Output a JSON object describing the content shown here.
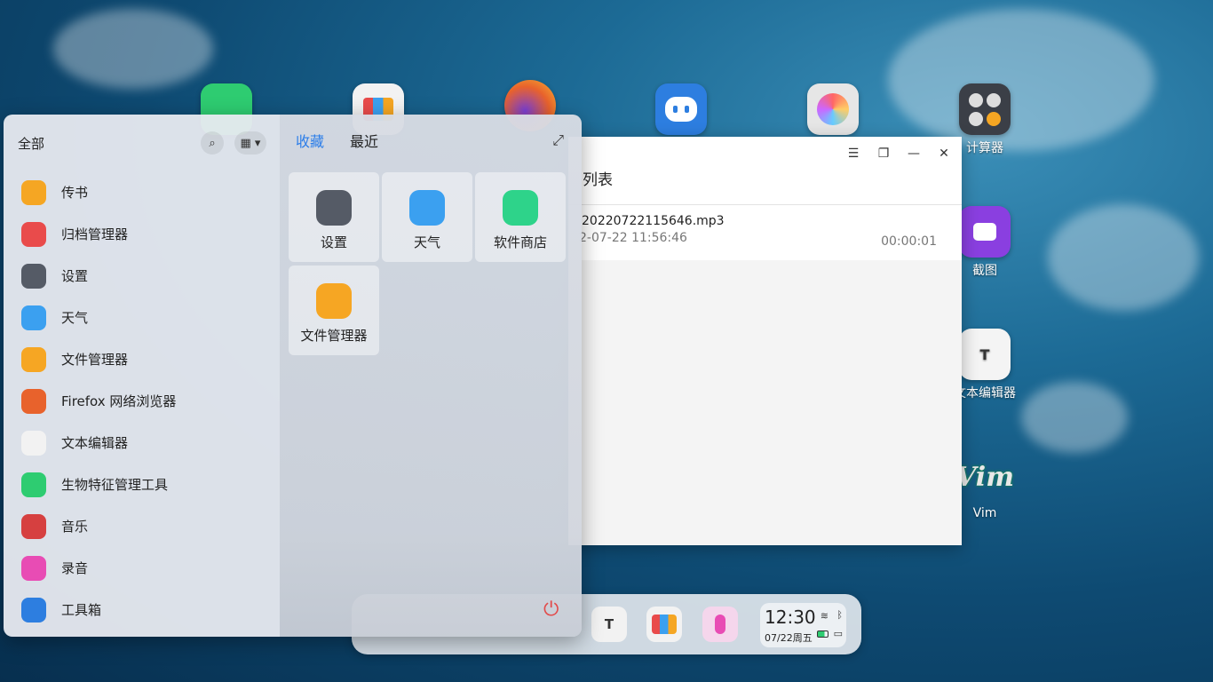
{
  "desktop": {
    "icons": [
      {
        "label": "计算器",
        "icon": "calculator-icon"
      },
      {
        "label": "截图",
        "icon": "screenshot-icon"
      },
      {
        "label": "文本编辑器",
        "icon": "text-editor-icon"
      },
      {
        "label": "Vim",
        "icon": "vim-icon"
      }
    ]
  },
  "recorder_window": {
    "list_title": "列表",
    "recording": {
      "name": "20220722115646.mp3",
      "date": "2-07-22 11:56:46",
      "duration": "00:00:01"
    },
    "controls": [
      "menu-icon",
      "restore-icon",
      "minimize-icon",
      "close-icon"
    ]
  },
  "launcher": {
    "category_label": "全部",
    "apps": [
      {
        "label": "传书",
        "icon": "chuanshu-icon",
        "color": "#f5a623"
      },
      {
        "label": "归档管理器",
        "icon": "archive-icon",
        "color": "#e94b4b"
      },
      {
        "label": "设置",
        "icon": "settings-icon",
        "color": "#555b66"
      },
      {
        "label": "天气",
        "icon": "weather-icon",
        "color": "#3ba0f0"
      },
      {
        "label": "文件管理器",
        "icon": "file-manager-icon",
        "color": "#f6a623"
      },
      {
        "label": "Firefox 网络浏览器",
        "icon": "firefox-icon",
        "color": "#e8622c"
      },
      {
        "label": "文本编辑器",
        "icon": "text-editor-icon",
        "color": "#f2f2f2"
      },
      {
        "label": "生物特征管理工具",
        "icon": "biometric-icon",
        "color": "#2ecc71"
      },
      {
        "label": "音乐",
        "icon": "music-icon",
        "color": "#d64040"
      },
      {
        "label": "录音",
        "icon": "recorder-icon",
        "color": "#e84cb4"
      },
      {
        "label": "工具箱",
        "icon": "toolbox-icon",
        "color": "#2d7ee0"
      }
    ],
    "tabs": {
      "favorites": "收藏",
      "recent": "最近"
    },
    "favorites": [
      {
        "label": "设置",
        "icon": "settings-icon",
        "color": "#555b66"
      },
      {
        "label": "天气",
        "icon": "weather-icon",
        "color": "#3ba0f0"
      },
      {
        "label": "软件商店",
        "icon": "store-icon",
        "color": "#2ed38a"
      },
      {
        "label": "文件管理器",
        "icon": "file-manager-icon",
        "color": "#f6a623"
      }
    ]
  },
  "dock": {
    "items": [
      {
        "icon": "text-editor-icon",
        "color": "#f2f2f2"
      },
      {
        "icon": "archive-icon",
        "color": "#e94b4b"
      },
      {
        "icon": "recorder-icon",
        "color": "#e84cb4"
      }
    ],
    "time": "12:30",
    "date": "07/22周五"
  }
}
